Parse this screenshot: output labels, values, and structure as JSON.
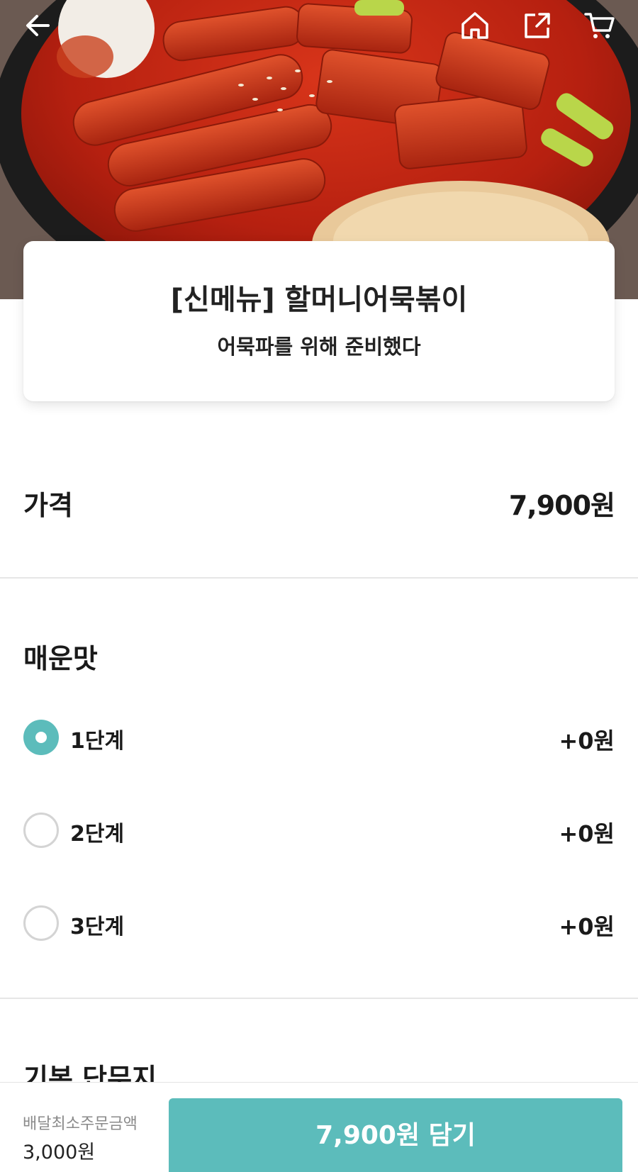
{
  "header": {
    "back_icon": "arrow-left-icon",
    "home_icon": "home-icon",
    "share_icon": "share-icon",
    "cart_icon": "cart-icon"
  },
  "product": {
    "name": "[신메뉴] 할머니어묵볶이",
    "description": "어묵파를 위해 준비했다"
  },
  "price": {
    "label": "가격",
    "value": "7,900원"
  },
  "spicy": {
    "title": "매운맛",
    "options": [
      {
        "label": "1단계",
        "price": "+0원",
        "selected": true
      },
      {
        "label": "2단계",
        "price": "+0원",
        "selected": false
      },
      {
        "label": "3단계",
        "price": "+0원",
        "selected": false
      }
    ]
  },
  "next_section": {
    "title": "기본 단무지"
  },
  "footer": {
    "min_order_label": "배달최소주문금액",
    "min_order_value": "3,000원",
    "cart_button_label": "7,900원 담기"
  },
  "colors": {
    "accent": "#5cbcbb",
    "radio_border": "#d4d4d4",
    "divider": "#e6e6e6"
  }
}
